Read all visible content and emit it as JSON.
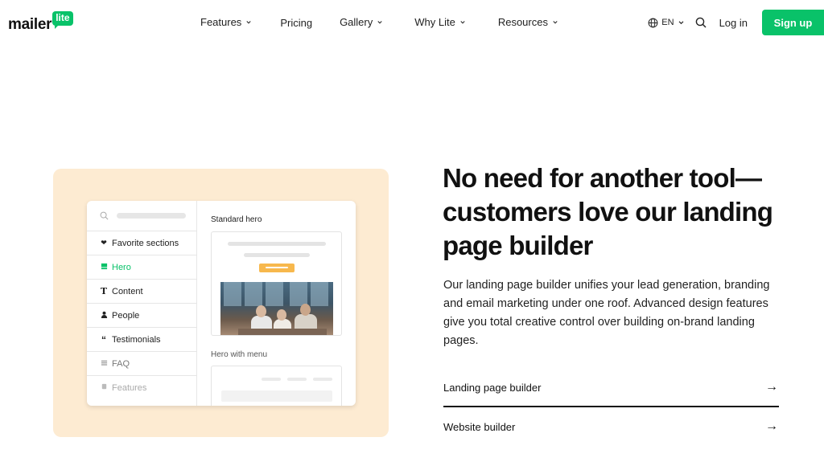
{
  "brand": {
    "name": "mailer",
    "badge": "lite",
    "accent": "#09c269"
  },
  "nav": {
    "items": [
      {
        "label": "Features",
        "has_dropdown": true
      },
      {
        "label": "Pricing",
        "has_dropdown": false
      },
      {
        "label": "Gallery",
        "has_dropdown": true
      },
      {
        "label": "Why Lite",
        "has_dropdown": true
      },
      {
        "label": "Resources",
        "has_dropdown": true
      }
    ],
    "language": "EN",
    "login": "Log in",
    "signup": "Sign up"
  },
  "illustration": {
    "sidebar": [
      {
        "label": "Favorite sections",
        "icon": "heart-icon"
      },
      {
        "label": "Hero",
        "icon": "hero-block-icon",
        "active": true
      },
      {
        "label": "Content",
        "icon": "text-icon"
      },
      {
        "label": "People",
        "icon": "people-icon"
      },
      {
        "label": "Testimonials",
        "icon": "quote-icon"
      },
      {
        "label": "FAQ",
        "icon": "list-icon"
      },
      {
        "label": "Features",
        "icon": "features-icon"
      }
    ],
    "sections": {
      "first": "Standard hero",
      "second": "Hero with menu"
    }
  },
  "hero": {
    "headline": "No need for another tool—customers love our landing page builder",
    "body": "Our landing page builder unifies your lead generation, branding and email marketing under one roof. Advanced design features give you total creative control over building on-brand landing pages.",
    "links": [
      {
        "label": "Landing page builder",
        "arrow": "→"
      },
      {
        "label": "Website builder",
        "arrow": "→"
      }
    ]
  }
}
